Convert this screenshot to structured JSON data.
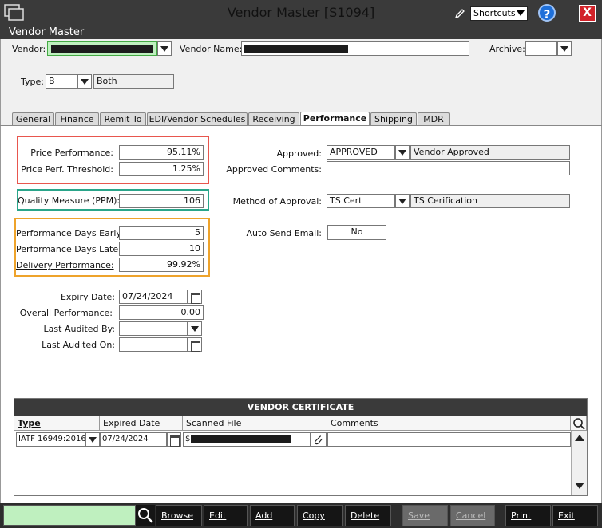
{
  "window": {
    "title": "Vendor Master [S1094]",
    "subtitle": "Vendor Master",
    "shortcuts": "Shortcuts",
    "help": "?",
    "close": "X"
  },
  "header": {
    "vendor_label": "Vendor:",
    "vendor_name_label": "Vendor Name:",
    "archive_label": "Archive:",
    "type_label": "Type:",
    "type_value": "B",
    "type_desc": "Both"
  },
  "tabs": [
    "General",
    "Finance",
    "Remit To",
    "EDI/Vendor Schedules",
    "Receiving",
    "Performance",
    "Shipping",
    "MDR"
  ],
  "performance": {
    "price_perf_label": "Price Performance:",
    "price_perf_value": "95.11%",
    "price_threshold_label": "Price Perf. Threshold:",
    "price_threshold_value": "1.25%",
    "quality_label": "Quality Measure (PPM):",
    "quality_value": "106",
    "days_early_label": "Performance Days Early:",
    "days_early_value": "5",
    "days_late_label": "Performance Days Late:",
    "days_late_value": "10",
    "delivery_label": "Delivery Performance:",
    "delivery_value": "99.92%",
    "expiry_label": "Expiry Date:",
    "expiry_value": "07/24/2024",
    "overall_label": "Overall Performance:",
    "overall_value": "0.00",
    "audited_by_label": "Last Audited By:",
    "audited_on_label": "Last Audited On:",
    "approved_label": "Approved:",
    "approved_value": "APPROVED",
    "approved_desc": "Vendor Approved",
    "approved_comments_label": "Approved Comments:",
    "method_label": "Method of Approval:",
    "method_value": "TS Cert",
    "method_desc": "TS Cerification",
    "auto_send_label": "Auto Send Email:",
    "auto_send_value": "No"
  },
  "certificate": {
    "title": "VENDOR CERTIFICATE",
    "columns": [
      "Type",
      "Expired Date",
      "Scanned File",
      "Comments"
    ],
    "rows": [
      {
        "type": "IATF 16949:2016",
        "expired": "07/24/2024",
        "file_prefix": "$"
      }
    ]
  },
  "toolbar": {
    "browse": "Browse",
    "edit": "Edit",
    "add": "Add",
    "copy": "Copy",
    "delete": "Delete",
    "save": "Save",
    "cancel": "Cancel",
    "print": "Print",
    "exit": "Exit"
  },
  "colors": {
    "price_box": "#e8564e",
    "quality_box": "#2aa58a",
    "delivery_box": "#eea32b",
    "vendor_field": "#bff0bf"
  }
}
